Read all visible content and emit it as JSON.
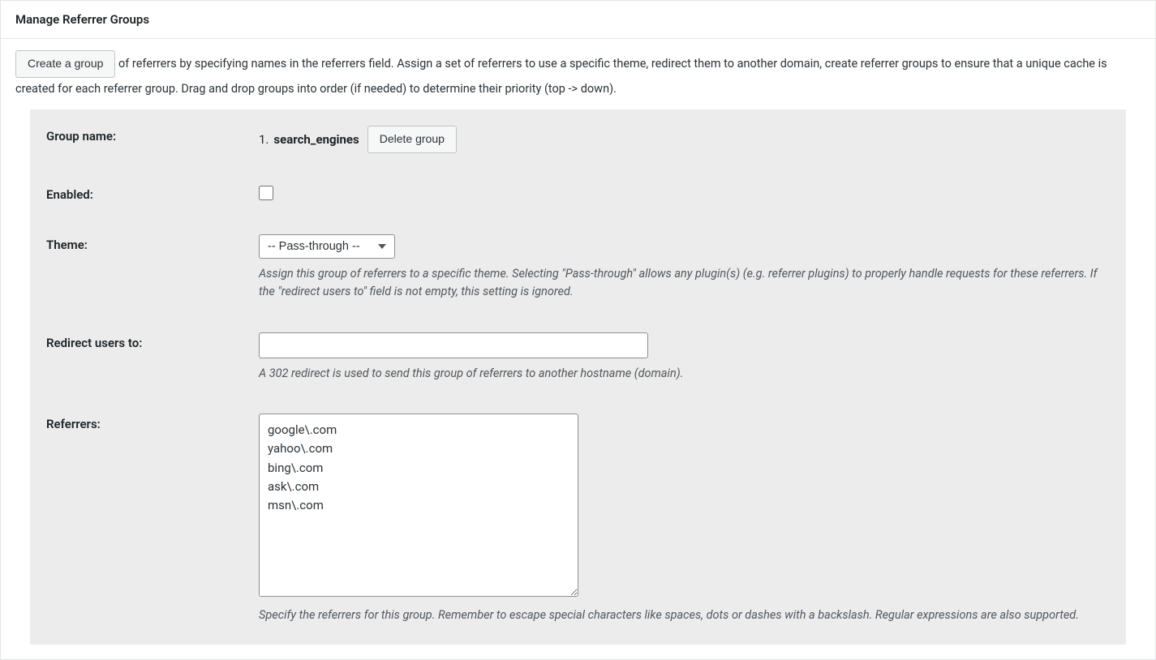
{
  "header": {
    "title": "Manage Referrer Groups"
  },
  "intro": {
    "create_button": "Create a group",
    "text_after_button": " of referrers by specifying names in the referrers field. Assign a set of referrers to use a specific theme, redirect them to another domain, create referrer groups to ensure that a unique cache is created for each referrer group. Drag and drop groups into order (if needed) to determine their priority (top -> down)."
  },
  "group": {
    "labels": {
      "group_name": "Group name:",
      "enabled": "Enabled:",
      "theme": "Theme:",
      "redirect": "Redirect users to:",
      "referrers": "Referrers:"
    },
    "number": "1.",
    "name": "search_engines",
    "delete_button": "Delete group",
    "enabled": false,
    "theme_selected": "-- Pass-through --",
    "theme_help": "Assign this group of referrers to a specific theme. Selecting \"Pass-through\" allows any plugin(s) (e.g. referrer plugins) to properly handle requests for these referrers. If the \"redirect users to\" field is not empty, this setting is ignored.",
    "redirect_value": "",
    "redirect_help": "A 302 redirect is used to send this group of referrers to another hostname (domain).",
    "referrers_value": "google\\.com\nyahoo\\.com\nbing\\.com\nask\\.com\nmsn\\.com",
    "referrers_help": "Specify the referrers for this group. Remember to escape special characters like spaces, dots or dashes with a backslash. Regular expressions are also supported."
  }
}
